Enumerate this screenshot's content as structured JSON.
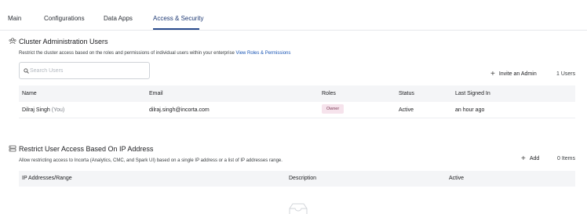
{
  "tabs": [
    {
      "label": "Main"
    },
    {
      "label": "Configurations"
    },
    {
      "label": "Data Apps"
    },
    {
      "label": "Access & Security"
    }
  ],
  "active_tab": "Access & Security",
  "accent_color": "#2a4b8d",
  "users_section": {
    "icon": "users-group-icon",
    "title": "Cluster Administration Users",
    "description": "Restrict the cluster access based on the roles and permissions of individual users within your enterprise",
    "link_label": "View Roles & Permissions",
    "search_placeholder": "Search Users",
    "search_value": "",
    "invite_label": "Invite an Admin",
    "count": "1 Users",
    "columns": {
      "name": "Name",
      "email": "Email",
      "roles": "Roles",
      "status": "Status",
      "last_signed_in": "Last Signed In"
    },
    "rows": [
      {
        "name": "Dilraj Singh",
        "you": "(You)",
        "email": "dilraj.singh@incorta.com",
        "role": "Owner",
        "status": "Active",
        "last_signed_in": "an hour ago"
      }
    ]
  },
  "ip_section": {
    "icon": "server-icon",
    "title": "Restrict User Access Based On IP Address",
    "description": "Allow restricting access to Incorta (Analytics, CMC, and Spark UI) based on a single IP address or a list of IP addresses range.",
    "add_label": "Add",
    "count": "0 Items",
    "columns": {
      "ip": "IP Addresses/Range",
      "description": "Description",
      "active": "Active"
    },
    "empty_icon": "empty-inbox-icon"
  }
}
